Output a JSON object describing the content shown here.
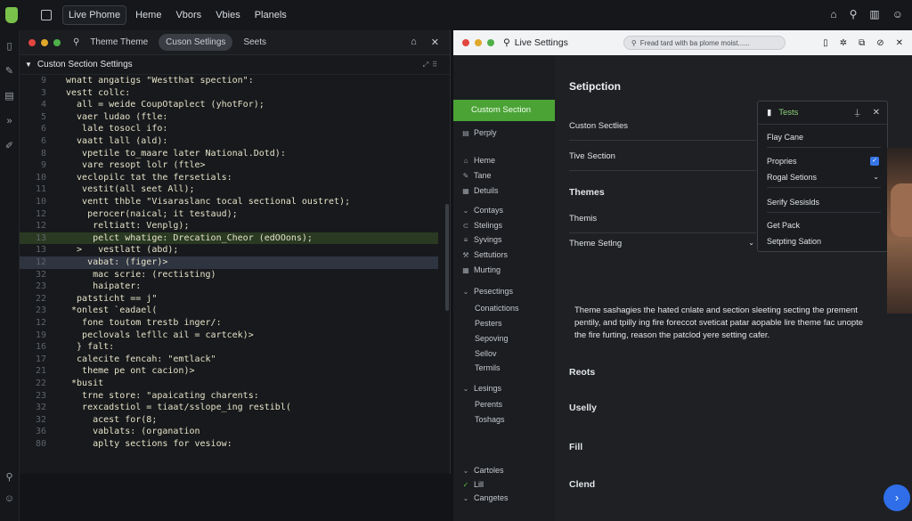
{
  "topbar": {
    "tabs": [
      "Live Phome",
      "Heme",
      "Vbors",
      "Vbies",
      "Planels"
    ],
    "active_index": 0,
    "icons": [
      "home-icon",
      "search-icon",
      "trash-icon",
      "user-icon"
    ]
  },
  "editor": {
    "tabs": [
      "Theme Theme",
      "Cuson Setlings",
      "Seets"
    ],
    "active_tab": 1,
    "section_title": "Custon Section Settings",
    "lines": [
      {
        "n": "9",
        "t": "wnatt angatigs \"Westthat spection\":",
        "hl": ""
      },
      {
        "n": "3",
        "t": "vestt collc:",
        "hl": ""
      },
      {
        "n": "4",
        "t": "  all = weide CoupOtaplect (yhotFor);",
        "hl": ""
      },
      {
        "n": "5",
        "t": "  vaer ludao (ftle:",
        "hl": ""
      },
      {
        "n": "6",
        "t": "   lale tosocl ifo:",
        "hl": ""
      },
      {
        "n": "6",
        "t": "  vaatt lall (ald):",
        "hl": ""
      },
      {
        "n": "8",
        "t": "   vpetile to_maare later National.Dotd):",
        "hl": ""
      },
      {
        "n": "9",
        "t": "   vare resopt lolr (ftle>",
        "hl": ""
      },
      {
        "n": "10",
        "t": "  veclopilc tat the fersetials:",
        "hl": ""
      },
      {
        "n": "11",
        "t": "   vestit(all seet All);",
        "hl": ""
      },
      {
        "n": "10",
        "t": "   ventt thble \"Visaraslanc tocal sectional oustret);",
        "hl": ""
      },
      {
        "n": "12",
        "t": "    perocer(naical; it testaud);",
        "hl": ""
      },
      {
        "n": "12",
        "t": "     reltiatt: Venplg);",
        "hl": ""
      },
      {
        "n": "13",
        "t": "     pelct whatige: Drecation_Cheor (edOOons);",
        "hl": "green"
      },
      {
        "n": "13",
        "t": "  >   vestlatt (abd);",
        "hl": ""
      },
      {
        "n": "12",
        "t": "    vabat: (figer)>",
        "hl": "blue"
      },
      {
        "n": "32",
        "t": "     mac scrie: (rectisting)",
        "hl": ""
      },
      {
        "n": "23",
        "t": "     haipater:",
        "hl": ""
      },
      {
        "n": "22",
        "t": "  patsticht == j\"",
        "hl": ""
      },
      {
        "n": "23",
        "t": " *onlest `eadael(",
        "hl": ""
      },
      {
        "n": "12",
        "t": "   fone toutom trestb inger/:",
        "hl": ""
      },
      {
        "n": "19",
        "t": "   peclovals lefllc ail = cartcek)>",
        "hl": ""
      },
      {
        "n": "16",
        "t": "  } falt:",
        "hl": ""
      },
      {
        "n": "17",
        "t": "  calecite fencah: \"emtlack\"",
        "hl": ""
      },
      {
        "n": "21",
        "t": "   theme pe ont cacion)>",
        "hl": ""
      },
      {
        "n": "22",
        "t": " *busit",
        "hl": ""
      },
      {
        "n": "23",
        "t": "   trne store: \"apaicating charents:",
        "hl": ""
      },
      {
        "n": "32",
        "t": "   rexcadstiol = tiaat/sslope_ing restibl(",
        "hl": ""
      },
      {
        "n": "32",
        "t": "     acest for(8;",
        "hl": ""
      },
      {
        "n": "36",
        "t": "     vablats: (organation",
        "hl": ""
      },
      {
        "n": "80",
        "t": "     aplty sections for vesiow:",
        "hl": ""
      }
    ]
  },
  "live": {
    "title": "Live Settings",
    "search_placeholder": "Fread tard with ba plome moist......",
    "sidebar": {
      "active": "Custom Section",
      "items": [
        {
          "label": "Perply",
          "icon": "page-icon",
          "sub": false
        },
        {
          "label": "Heme",
          "icon": "home-icon",
          "sub": false
        },
        {
          "label": "Tane",
          "icon": "edit-icon",
          "sub": false
        },
        {
          "label": "Detuils",
          "icon": "grid-icon",
          "sub": false
        },
        {
          "label": "Contays",
          "icon": "chevron-down-icon",
          "sub": false
        },
        {
          "label": "Stelings",
          "icon": "link-icon",
          "sub": false
        },
        {
          "label": "Syvings",
          "icon": "list-icon",
          "sub": false
        },
        {
          "label": "Settutiors",
          "icon": "tool-icon",
          "sub": false
        },
        {
          "label": "Murting",
          "icon": "grid-icon",
          "sub": false
        },
        {
          "label": "Pesectings",
          "icon": "chevron-down-icon",
          "sub": false
        },
        {
          "label": "Conatictions",
          "icon": "",
          "sub": true
        },
        {
          "label": "Pesters",
          "icon": "",
          "sub": true
        },
        {
          "label": "Sepoving",
          "icon": "",
          "sub": true
        },
        {
          "label": "Sellov",
          "icon": "",
          "sub": true
        },
        {
          "label": "Termils",
          "icon": "",
          "sub": true
        },
        {
          "label": "Lesings",
          "icon": "chevron-down-icon",
          "sub": false
        },
        {
          "label": "Perents",
          "icon": "",
          "sub": true
        },
        {
          "label": "Toshags",
          "icon": "",
          "sub": true
        },
        {
          "label": "Cartoles",
          "icon": "chevron-down-icon",
          "sub": false
        },
        {
          "label": "Lill",
          "icon": "check-icon",
          "sub": false
        },
        {
          "label": "Cangetes",
          "icon": "chevron-down-icon",
          "sub": false
        }
      ]
    },
    "main": {
      "title": "Setipction",
      "rows": [
        {
          "label": "Custon Sectlies",
          "big": false,
          "chev": false
        },
        {
          "label": "Tive Section",
          "big": false,
          "chev": false
        },
        {
          "label": "Themes",
          "big": true,
          "chev": false
        },
        {
          "label": "Themis",
          "big": false,
          "chev": false
        },
        {
          "label": "Theme Setlng",
          "big": false,
          "chev": true
        }
      ],
      "description": "Theme sashagies the hated cnlate and section sleeting secting the prement pentily, and tpilly ing fire foreccot sveticat patar aopable lire theme fac unopte the fire furting, reason the patclod yere setting cafer.",
      "lower": [
        "Reots",
        "Uselly",
        "Fill",
        "Clend"
      ]
    },
    "popup": {
      "title": "Tests",
      "items": [
        {
          "label": "Flay Cane",
          "mark": ""
        },
        {
          "label": "Propries",
          "mark": "check"
        },
        {
          "label": "Rogal Setions",
          "mark": "chevron"
        },
        {
          "label": "Serify Sesislds",
          "mark": ""
        },
        {
          "label": "Get Pack",
          "mark": ""
        },
        {
          "label": "Setpting Sation",
          "mark": ""
        }
      ]
    }
  }
}
